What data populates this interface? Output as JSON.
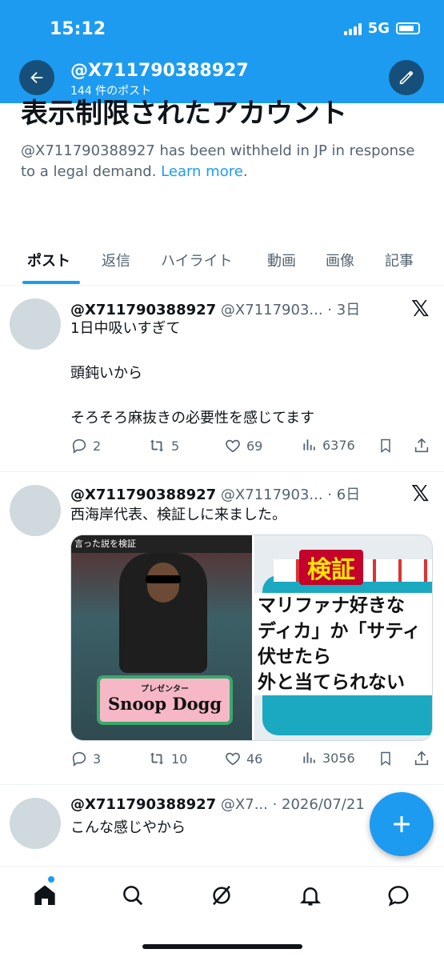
{
  "status_bar": {
    "time": "15:12",
    "network": "5G"
  },
  "header": {
    "title": "@X711790388927",
    "subtitle": "144 件のポスト"
  },
  "withheld": {
    "title": "表示制限されたアカウント",
    "text": "@X711790388927 has been withheld in JP in response to a legal demand.",
    "link": "Learn more",
    "suffix": "."
  },
  "tabs": [
    {
      "label": "ポスト",
      "active": true
    },
    {
      "label": "返信"
    },
    {
      "label": "ハイライト"
    },
    {
      "label": "動画"
    },
    {
      "label": "画像"
    },
    {
      "label": "記事"
    }
  ],
  "tweets": [
    {
      "name": "@X711790388927",
      "handle": "@X7117903...",
      "time": "3日",
      "text": "1日中吸いすぎて\n\n頭鈍いから\n\nそろそろ麻抜きの必要性を感じてます",
      "replies": "2",
      "reposts": "5",
      "likes": "69",
      "views": "6376"
    },
    {
      "name": "@X711790388927",
      "handle": "@X7117903...",
      "time": "6日",
      "text": "西海岸代表、検証しに来ました。",
      "replies": "3",
      "reposts": "10",
      "likes": "46",
      "views": "3056",
      "media": {
        "left_banner": "言った説を検証",
        "plaque_small": "プレゼンター",
        "plaque_big": "Snoop Dogg",
        "right_badge": "検証",
        "right_text": "マリファナ好きな\nディカ」か「サティ\n伏せたら\n外と当てられない"
      }
    },
    {
      "name": "@X711790388927",
      "handle": "@X7...",
      "time": "2026/07/21",
      "text": "こんな感じやから"
    }
  ],
  "colors": {
    "accent": "#1d9bf0",
    "text": "#0f1419",
    "muted": "#536471"
  },
  "icons": {
    "back": "arrow-left-icon",
    "compose": "pencil-icon",
    "logo": "x-logo-icon",
    "nav": [
      "home-icon",
      "search-icon",
      "grok-icon",
      "bell-icon",
      "messages-icon"
    ]
  }
}
